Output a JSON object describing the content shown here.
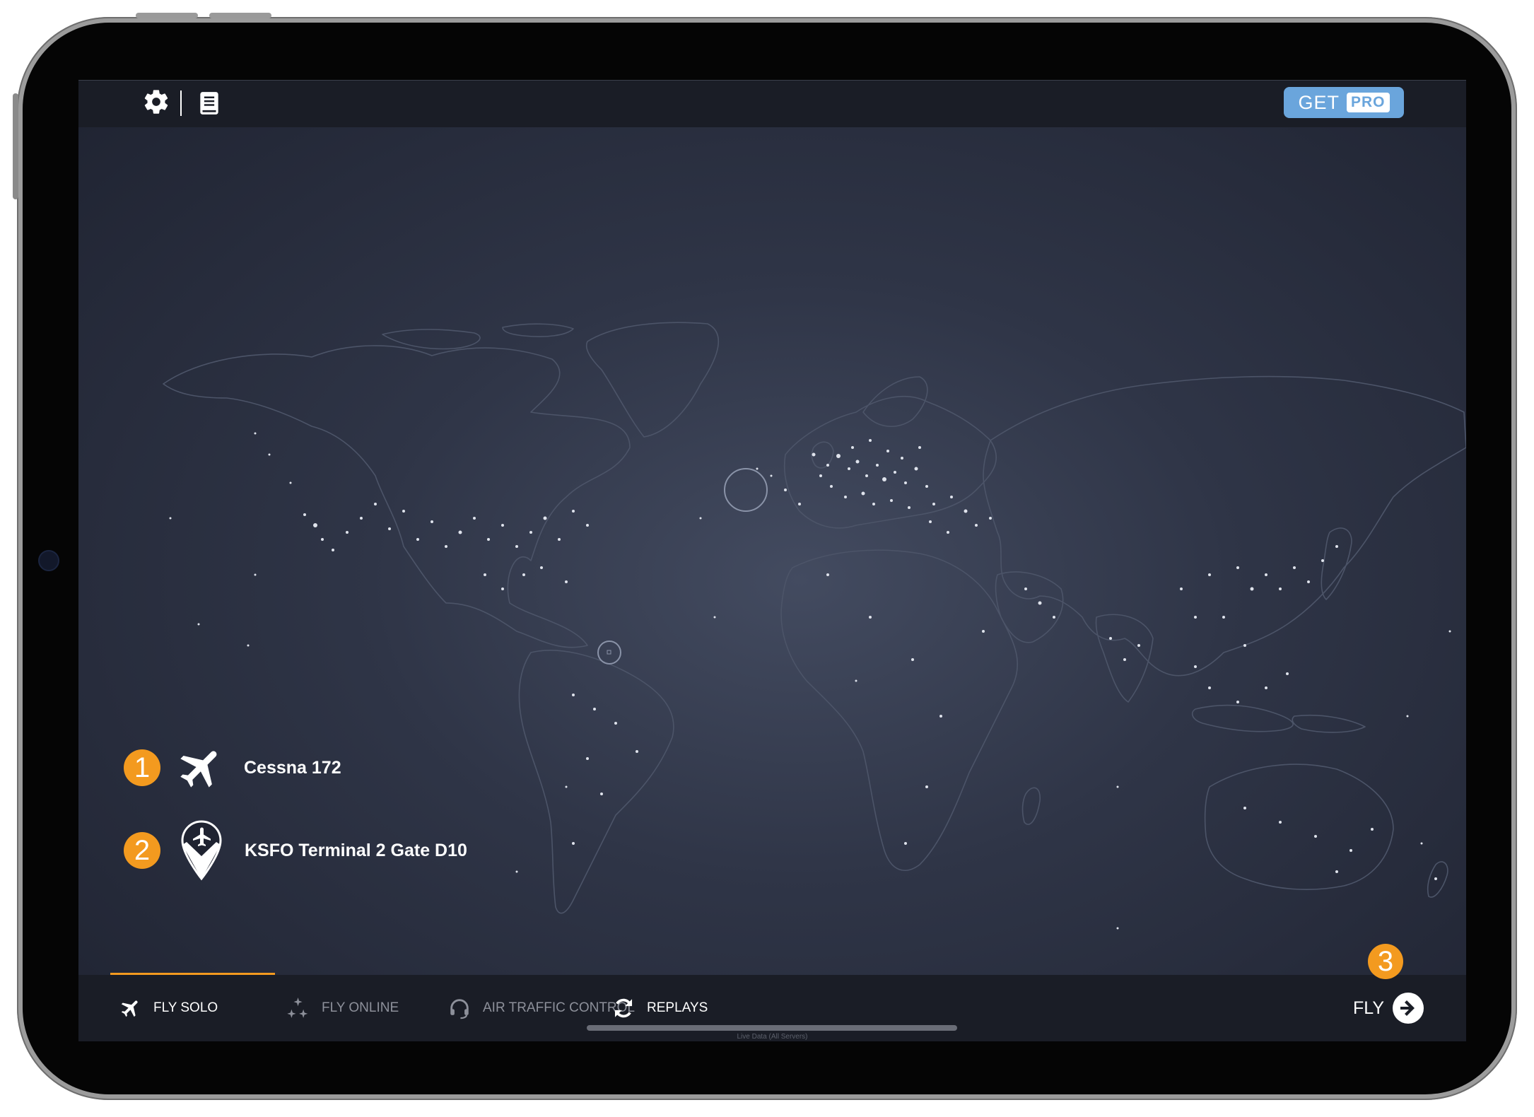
{
  "topbar": {
    "settings_icon": "gear-icon",
    "logbook_icon": "book-icon",
    "get_label": "GET",
    "pro_label": "PRO"
  },
  "selection": {
    "aircraft": {
      "step": "1",
      "icon": "airplane-icon",
      "label": "Cessna 172"
    },
    "location": {
      "step": "2",
      "icon": "airport-pin-icon",
      "label": "KSFO Terminal 2 Gate D10"
    }
  },
  "tabs": [
    {
      "label": "FLY SOLO",
      "icon": "airplane-icon",
      "active": true
    },
    {
      "label": "FLY ONLINE",
      "icon": "multiplayer-icon",
      "active": false
    },
    {
      "label": "AIR TRAFFIC CONTROL",
      "icon": "headset-icon",
      "active": false
    },
    {
      "label": "REPLAYS",
      "icon": "refresh-icon",
      "active": false
    }
  ],
  "fly": {
    "step": "3",
    "label": "FLY",
    "icon": "arrow-right-icon"
  },
  "status": {
    "live_data": "Live Data (All Servers)"
  },
  "colors": {
    "accent": "#f39a1f",
    "pro_blue": "#6aa5dc",
    "bar_bg": "#1a1d26"
  }
}
